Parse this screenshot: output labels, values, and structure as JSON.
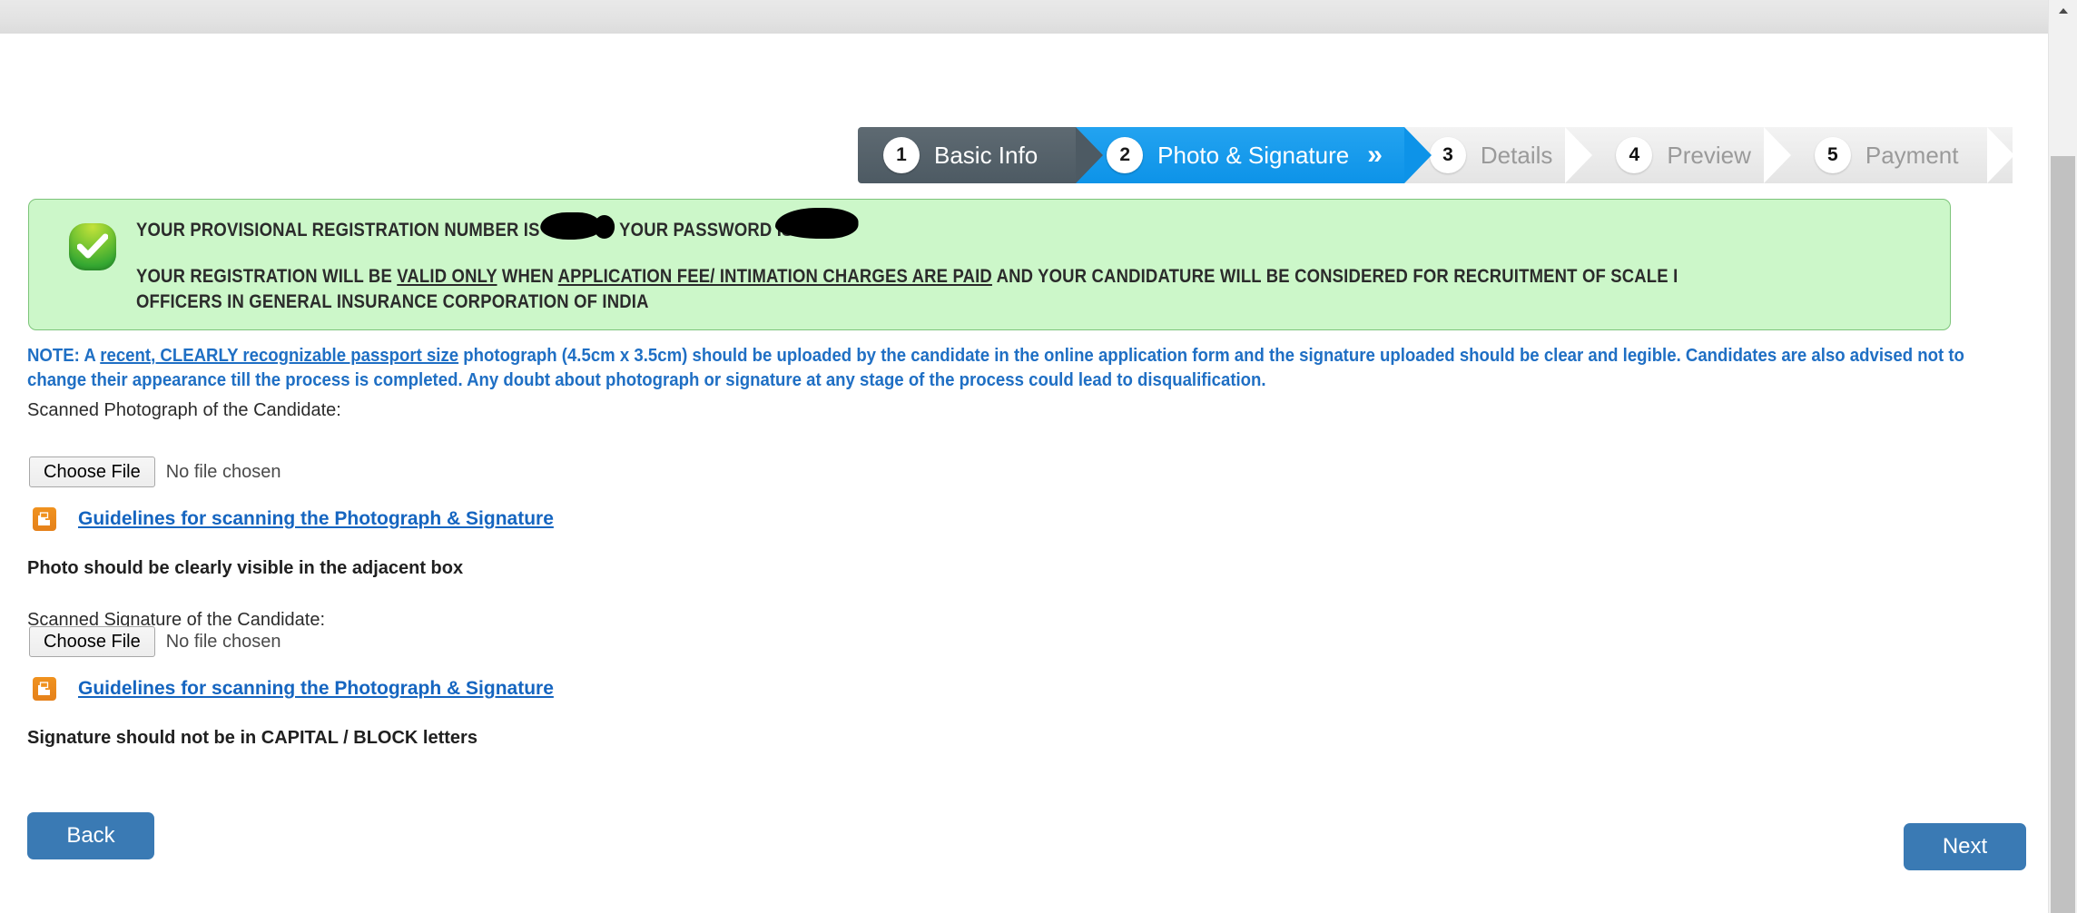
{
  "window": {
    "scrollbar_up_icon": "triangle-up-icon"
  },
  "wizard": {
    "steps": [
      {
        "num": "1",
        "label": "Basic Info",
        "state": "done"
      },
      {
        "num": "2",
        "label": "Photo & Signature",
        "state": "active",
        "chevron": "»"
      },
      {
        "num": "3",
        "label": "Details",
        "state": "todo"
      },
      {
        "num": "4",
        "label": "Preview",
        "state": "todo"
      },
      {
        "num": "5",
        "label": "Payment",
        "state": "todo"
      }
    ],
    "colors": {
      "done": "#4d5a63",
      "active": "#0d93e8",
      "todo": "#e4e4e4",
      "todo_text": "#9a9a9a"
    }
  },
  "banner": {
    "icon": "success-check-icon",
    "background": "#ccf7c9",
    "border": "#7dc47a",
    "line1_pre": "YOUR PROVISIONAL REGISTRATION NUMBER IS 480",
    "line1_mid": "AND YOUR PASSWORD IS",
    "line1_post": ".",
    "line2_a": "YOUR REGISTRATION WILL BE ",
    "line2_u1": "VALID ONLY",
    "line2_b": " WHEN ",
    "line2_u2": "APPLICATION FEE/ INTIMATION CHARGES ARE PAID",
    "line2_c": " AND YOUR CANDIDATURE WILL BE CONSIDERED FOR RECRUITMENT OF SCALE I OFFICERS IN GENERAL INSURANCE CORPORATION OF INDIA"
  },
  "note": {
    "color": "#1f6fc4",
    "prefix": "NOTE: A ",
    "underlined": "recent, CLEARLY recognizable passport size",
    "body": " photograph (4.5cm x 3.5cm) should be uploaded by the candidate in the online application form and the signature uploaded should be clear and legible. Candidates are also advised not to change their appearance till the process is completed. Any doubt about photograph or signature at any stage of the process could lead to disqualification."
  },
  "photo_section": {
    "label": "Scanned Photograph of the Candidate:",
    "choose_file_label": "Choose File",
    "file_status": "No file chosen",
    "guideline_icon": "pdf-document-icon",
    "guideline_link": "Guidelines for scanning the Photograph & Signature",
    "hint": "Photo should be clearly visible in the adjacent box"
  },
  "signature_section": {
    "label": "Scanned Signature of the Candidate:",
    "choose_file_label": "Choose File",
    "file_status": "No file chosen",
    "guideline_icon": "pdf-document-icon",
    "guideline_link": "Guidelines for scanning the Photograph & Signature",
    "hint": "Signature should not be in CAPITAL / BLOCK letters"
  },
  "navigation": {
    "back_label": "Back",
    "next_label": "Next",
    "button_color": "#3a7ab4"
  }
}
